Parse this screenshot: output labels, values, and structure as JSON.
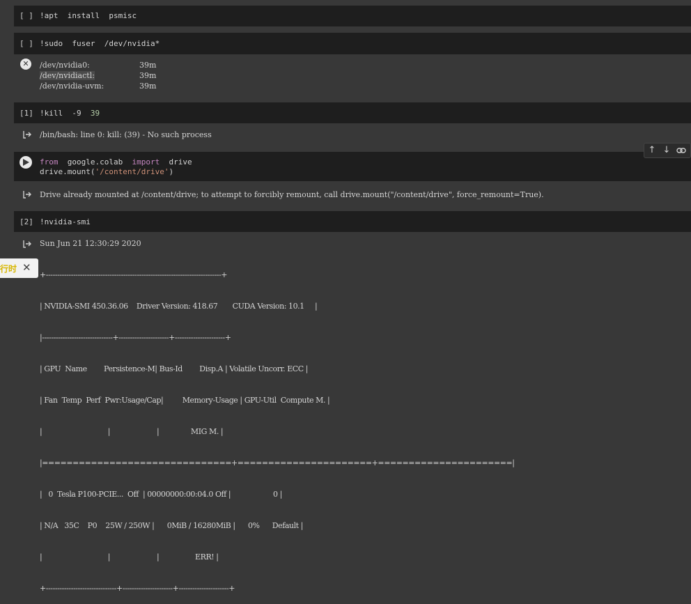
{
  "cells": [
    {
      "exec": "[ ]",
      "code": "!apt  install  psmisc"
    },
    {
      "exec": "[ ]",
      "code": "!sudo  fuser  /dev/nvidia*"
    },
    {
      "exec": "[1]",
      "code_parts": [
        "!kill  -9  ",
        "39"
      ]
    },
    {
      "exec": "",
      "code_line1": [
        "from",
        "  google.colab  ",
        "import",
        "  drive"
      ],
      "code_line2": [
        "drive.mount",
        "(",
        "'/content/drive'",
        ")"
      ]
    },
    {
      "exec": "[2]",
      "code": "!nvidia-smi"
    }
  ],
  "outputs": {
    "fuser": [
      {
        "path": "/dev/nvidia0:",
        "val": "39m"
      },
      {
        "path": "/dev/nvidiactl:",
        "val": "39m"
      },
      {
        "path": "/dev/nvidia-uvm:",
        "val": "39m"
      }
    ],
    "kill": "/bin/bash: line 0: kill: (39) - No such process",
    "drive": "Drive already mounted at /content/drive; to attempt to forcibly remount, call drive.mount(\"/content/drive\", force_remount=True).",
    "smi_date": "Sun Jun 21 12:30:29 2020",
    "smi_lines": [
      "+-----------------------------------------------------------------------------+",
      "| NVIDIA-SMI 450.36.06    Driver Version: 418.67       CUDA Version: 10.1     |",
      "|-------------------------------+----------------------+----------------------+",
      "| GPU  Name        Persistence-M| Bus-Id        Disp.A | Volatile Uncorr. ECC |",
      "| Fan  Temp  Perf  Pwr:Usage/Cap|         Memory-Usage | GPU-Util  Compute M. |",
      "|                               |                      |               MIG M. |",
      "|===============================+======================+======================|",
      "|   0  Tesla P100-PCIE...  Off  | 00000000:00:04.0 Off |                    0 |",
      "| N/A   35C    P0    25W / 250W |      0MiB / 16280MiB |      0%      Default |",
      "|                               |                      |                 ERR! |",
      "+-------------------------------+----------------------+----------------------+"
    ]
  },
  "toast": {
    "text": "行时",
    "close": "✕"
  },
  "icons": {
    "error": "✕",
    "output": "output-arrow-icon",
    "up": "↑",
    "down": "↓",
    "link": "link-icon"
  }
}
